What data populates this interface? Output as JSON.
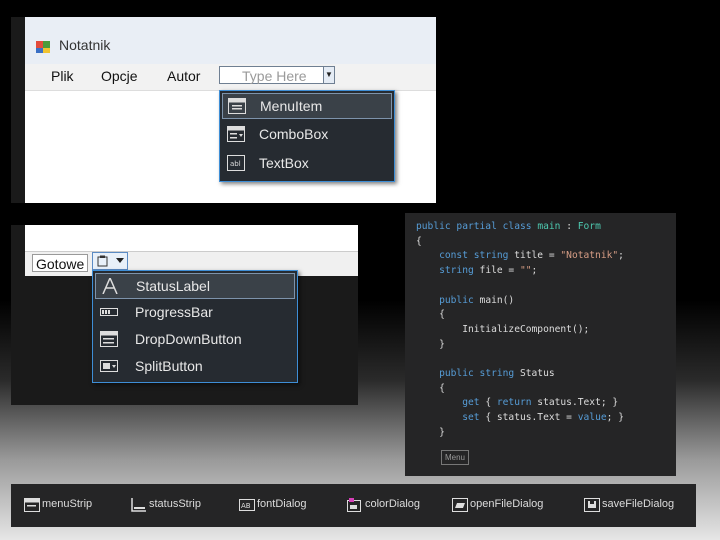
{
  "window": {
    "title": "Notatnik",
    "menu": [
      "Plik",
      "Opcje",
      "Autor"
    ],
    "type_here": "Type Here",
    "dropdown": [
      {
        "label": "MenuItem",
        "icon": "menu-item-icon",
        "highlighted": true
      },
      {
        "label": "ComboBox",
        "icon": "combobox-icon",
        "highlighted": false
      },
      {
        "label": "TextBox",
        "icon": "textbox-icon",
        "highlighted": false
      }
    ]
  },
  "statusstrip": {
    "label": "Gotowe",
    "dropdown": [
      {
        "label": "StatusLabel",
        "icon": "status-label-icon",
        "highlighted": true
      },
      {
        "label": "ProgressBar",
        "icon": "progressbar-icon",
        "highlighted": false
      },
      {
        "label": "DropDownButton",
        "icon": "dropdown-button-icon",
        "highlighted": false
      },
      {
        "label": "SplitButton",
        "icon": "split-button-icon",
        "highlighted": false
      }
    ]
  },
  "code": {
    "lines": [
      "public partial class main : Form",
      "{",
      "    const string title = \"Notatnik\";",
      "    string file = \"\";",
      "",
      "    public main()",
      "    {",
      "        InitializeComponent();",
      "    }",
      "",
      "    public string Status",
      "    {",
      "        get { return status.Text; }",
      "        set { status.Text = value; }",
      "    }"
    ],
    "tag": "Menu"
  },
  "components": [
    {
      "label": "menuStrip",
      "icon": "menustrip-icon"
    },
    {
      "label": "statusStrip",
      "icon": "statusstrip-icon"
    },
    {
      "label": "fontDialog",
      "icon": "fontdialog-icon"
    },
    {
      "label": "colorDialog",
      "icon": "colordialog-icon"
    },
    {
      "label": "openFileDialog",
      "icon": "openfiledialog-icon"
    },
    {
      "label": "saveFileDialog",
      "icon": "savefiledialog-icon"
    }
  ],
  "colors": {
    "keyword": "#569cd6",
    "string": "#d69d85",
    "type": "#4ec9b0",
    "dropdown_border": "#3e8ed6"
  }
}
